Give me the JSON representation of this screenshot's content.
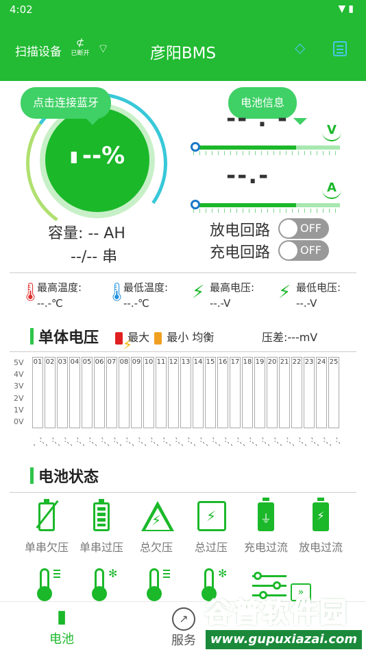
{
  "status_bar": {
    "time": "4:02",
    "system_icons": [
      "wifi-icon",
      "battery-icon"
    ]
  },
  "header": {
    "scan_label": "扫描设备",
    "bluetooth_state": "已断开",
    "title": "彦阳BMS",
    "icons": [
      "bluetooth-off-icon",
      "wifi-icon",
      "tag-icon",
      "book-icon"
    ]
  },
  "tooltips": {
    "connect": "点击连接蓝牙",
    "battery_info": "电池信息"
  },
  "gauge": {
    "percent": "--%",
    "capacity_label": "容量:",
    "capacity_value": "-- AH",
    "series_value": "--/-- 串"
  },
  "readouts": {
    "voltage_dash": "-- . -",
    "current_dash": "--.-",
    "voltage_symbol": "V",
    "current_symbol": "A"
  },
  "switches": {
    "discharge_label": "放电回路",
    "discharge_state": "OFF",
    "charge_label": "充电回路",
    "charge_state": "OFF"
  },
  "temps": [
    {
      "label": "最高温度:",
      "value": "--.-℃",
      "icon": "thermometer-hot-icon",
      "color": "#e03030"
    },
    {
      "label": "最低温度:",
      "value": "--.-℃",
      "icon": "thermometer-cold-icon",
      "color": "#2090e0"
    },
    {
      "label": "最高电压:",
      "value": "--.-V",
      "icon": "bolt-icon",
      "color": "#1bb82a"
    },
    {
      "label": "最低电压:",
      "value": "--.-V",
      "icon": "bolt-icon",
      "color": "#1bb82a"
    }
  ],
  "cell_section": {
    "title": "单体电压",
    "max_label": "最大",
    "min_label": "最小",
    "balance_label": "均衡",
    "pressure_diff": "压差:---mV",
    "y_ticks": [
      "5V",
      "4V",
      "3V",
      "2V",
      "1V",
      "0V"
    ],
    "cells": [
      "01",
      "02",
      "03",
      "04",
      "05",
      "06",
      "07",
      "08",
      "09",
      "10",
      "11",
      "12",
      "13",
      "14",
      "15",
      "16",
      "17",
      "18",
      "19",
      "20",
      "21",
      "22",
      "23",
      "24",
      "25"
    ],
    "cell_values": "-.--"
  },
  "status_section": {
    "title": "电池状态",
    "items": [
      {
        "label": "单串欠压",
        "icon": "battery-slash-icon"
      },
      {
        "label": "单串过压",
        "icon": "battery-full-icon"
      },
      {
        "label": "总欠压",
        "icon": "warning-bolt-icon"
      },
      {
        "label": "总过压",
        "icon": "box-bolt-icon"
      },
      {
        "label": "充电过流",
        "icon": "battery-plug-icon"
      },
      {
        "label": "放电过流",
        "icon": "battery-bolt-icon"
      }
    ],
    "row2_icons": [
      "thermometer-icon",
      "thermometer-snow-icon",
      "thermometer-icon",
      "thermometer-snow-icon",
      "sliders-icon"
    ]
  },
  "bottom_nav": [
    {
      "label": "电池",
      "icon": "battery-bolt-icon",
      "active": true
    },
    {
      "label": "服务",
      "icon": "compass-icon",
      "active": false
    }
  ],
  "watermark": {
    "brand": "谷普软件园",
    "url": "www.gupuxiazai.com"
  }
}
